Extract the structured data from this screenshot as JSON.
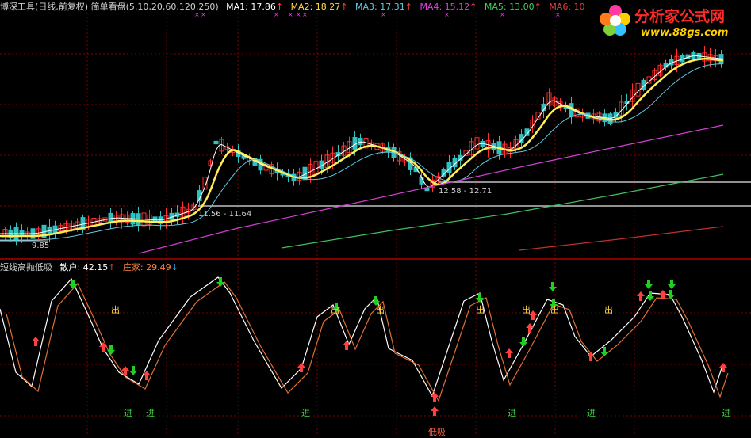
{
  "header": {
    "title": "博深工具(日线,前复权) 简单看盘(5,10,20,60,120,250)",
    "ma": [
      {
        "label": "MA1: 17.86",
        "arrow": "↑",
        "color": "#ffffff"
      },
      {
        "label": "MA2: 18.27",
        "arrow": "↑",
        "color": "#ffdc40"
      },
      {
        "label": "MA3: 17.31",
        "arrow": "↑",
        "color": "#60c8e0"
      },
      {
        "label": "MA4: 15.12",
        "arrow": "↑",
        "color": "#e040e0"
      },
      {
        "label": "MA5: 13.00",
        "arrow": "↑",
        "color": "#40d060"
      },
      {
        "label": "MA6: 10",
        "arrow": "",
        "color": "#e04040"
      }
    ]
  },
  "logo": {
    "title": "分析家公式网",
    "url": "www.88gs.com"
  },
  "price_labels": {
    "low1": "9.85",
    "range1": "11.56 - 11.64",
    "range2": "12.58 - 12.71"
  },
  "indicator": {
    "title": "短线高抛低吸",
    "retail_label": "散户: 42.15",
    "retail_arrow": "↑",
    "banker_label": "庄家: 29.49",
    "banker_arrow": "↓"
  },
  "signals": {
    "out": "出",
    "in": "进",
    "low": "低吸"
  },
  "colors": {
    "up": "#ff3030",
    "down": "#30c0c0",
    "ma_white": "#ffffff",
    "ma_yellow": "#ffee55",
    "ma_cyan": "#60c8e0",
    "ma_magenta": "#d040d0",
    "ma_green": "#40c060",
    "ma_red": "#c03030",
    "buy": "#ff4040",
    "sell": "#20d020",
    "grid": "#7a0000"
  }
}
